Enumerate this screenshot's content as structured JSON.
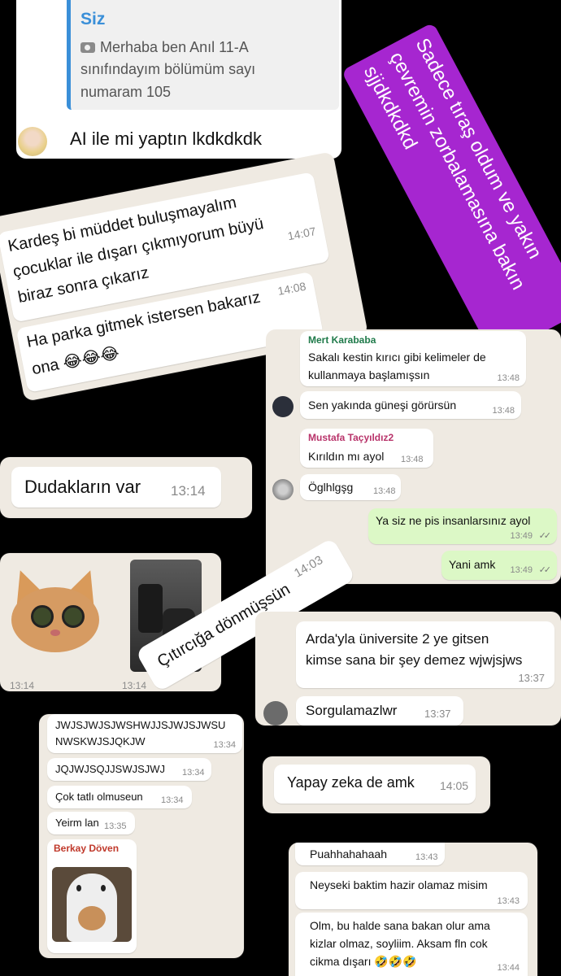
{
  "panel1": {
    "reply_name": "Siz",
    "reply_text_line1": "Merhaba ben Anıl 11-A",
    "reply_text_line2": "sınıfındayım bölümüm sayı",
    "reply_text_line3": "numaram 105",
    "message": "AI ile mi yaptın lkdkdkdk"
  },
  "story_caption": {
    "line1": "Sadece tıraş oldum ve yakın",
    "line2": "çevremin zorbalamasına bakın",
    "line3": "sjjdkdkdkd"
  },
  "panel2": {
    "msg1_line1": "Kardeş bi müddet buluşmayalım",
    "msg1_line2": "çocuklar ile dışarı çıkmıyorum büyü",
    "msg1_line3": "biraz sonra çıkarız",
    "msg1_time": "14:07",
    "msg2_line1": "Ha parka gitmek istersen bakarız",
    "msg2_line2": "ona 😂😂😂",
    "msg2_time": "14:08"
  },
  "panel3": {
    "sender1": "Mert Karababa",
    "msg1_line1": "Sakalı kestin kırıcı gibi kelimeler de",
    "msg1_line2": "kullanmaya başlamışsın",
    "msg1_time": "13:48",
    "msg2": "Sen yakında güneşi görürsün",
    "msg2_time": "13:48",
    "sender3": "Mustafa Taçyıldız2",
    "msg3": "Kırıldın mı ayol",
    "msg3_time": "13:48",
    "msg4": "Öglhlgşg",
    "msg4_time": "13:48",
    "out1": "Ya siz ne pis insanlarsınız ayol",
    "out1_time": "13:49",
    "out2": "Yani amk",
    "out2_time": "13:49",
    "tick_glyph": "✓✓"
  },
  "panel4": {
    "message": "Dudakların var",
    "time": "13:14"
  },
  "panel5": {
    "time_left": "13:14",
    "time_right": "13:14"
  },
  "panel6": {
    "message": "Çıtırcığa dönmüşsün",
    "time": "14:03"
  },
  "panel7": {
    "msg1_line1": "Arda'yla üniversite 2 ye gitsen",
    "msg1_line2": "kimse sana bir şey demez wjwjsjws",
    "msg1_time": "13:37",
    "msg2": "Sorgulamazlwr",
    "msg2_time": "13:37"
  },
  "panel8": {
    "msg1_line1": "JWJSJWJSJWSHWJJSJWJSJWSU",
    "msg1_line2": "NWSKWJSJQKJW",
    "msg1_time": "13:34",
    "msg2": "JQJWJSQJJSWJSJWJ",
    "msg2_time": "13:34",
    "msg3": "Çok tatlı olmuseun",
    "msg3_time": "13:34",
    "msg4": "Yeirm lan",
    "msg4_time": "13:35",
    "sender": "Berkay Döven"
  },
  "panel9": {
    "message": "Yapay zeka de amk",
    "time": "14:05"
  },
  "panel10": {
    "msg1": "Puahhahahaah",
    "msg1_time": "13:43",
    "msg2": "Neyseki baktim hazir olamaz misim",
    "msg2_time": "13:43",
    "msg3_line1": "Olm, bu halde sana bakan olur ama",
    "msg3_line2": "kizlar olmaz, soyliim. Aksam fln cok",
    "msg3_line3": "cikma dışarı 🤣🤣🤣",
    "msg3_time": "13:44"
  },
  "colors": {
    "background": "#000000",
    "chat_bg": "#efeae2",
    "outgoing_bubble": "#dcf8c6",
    "caption_purple": "#a626d0",
    "sender_green": "#1f7a4a",
    "sender_pink": "#b8336a",
    "sender_red": "#c0392b",
    "reply_blue": "#3a8fd8"
  }
}
